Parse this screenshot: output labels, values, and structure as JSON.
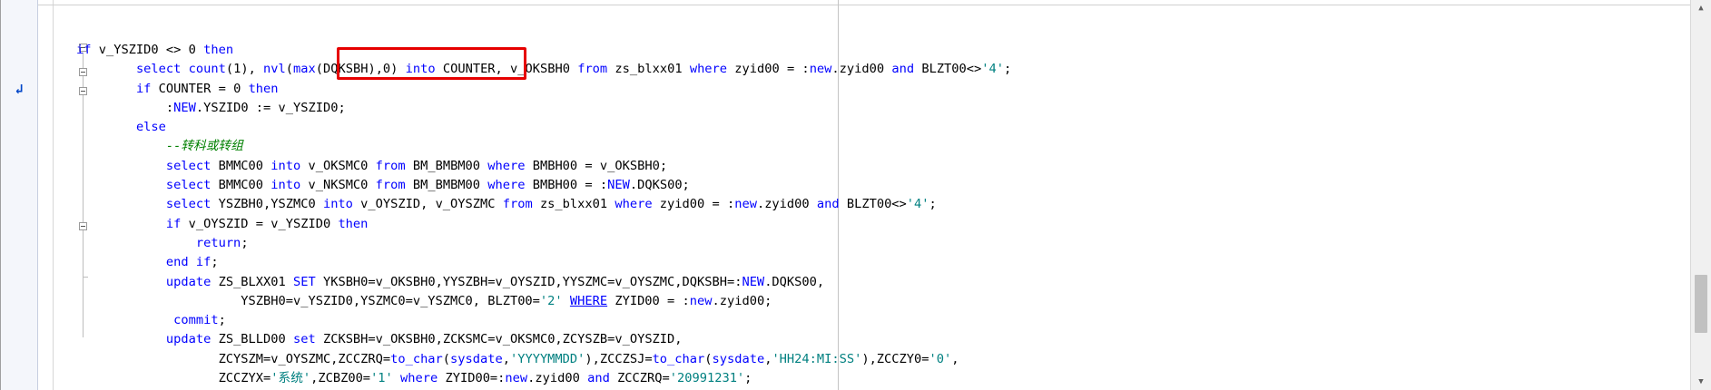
{
  "editor": {
    "lines": [
      [
        {
          "t": "if",
          "c": "kw"
        },
        {
          "t": " v_YSZID0 <> 0 "
        },
        {
          "t": "then",
          "c": "kw"
        }
      ],
      [
        {
          "t": "        "
        },
        {
          "t": "select",
          "c": "kw"
        },
        {
          "t": " "
        },
        {
          "t": "count",
          "c": "fn"
        },
        {
          "t": "(1), "
        },
        {
          "t": "nvl",
          "c": "fn"
        },
        {
          "t": "("
        },
        {
          "t": "max",
          "c": "fn"
        },
        {
          "t": "(DQKSBH),0) "
        },
        {
          "t": "into",
          "c": "kw"
        },
        {
          "t": " COUNTER, v_OKSBH0 "
        },
        {
          "t": "from",
          "c": "kw"
        },
        {
          "t": " zs_blxx01 "
        },
        {
          "t": "where",
          "c": "kw"
        },
        {
          "t": " zyid00 = :"
        },
        {
          "t": "new",
          "c": "kw"
        },
        {
          "t": ".zyid00 "
        },
        {
          "t": "and",
          "c": "kw"
        },
        {
          "t": " BLZT00<>"
        },
        {
          "t": "'4'",
          "c": "str"
        },
        {
          "t": ";"
        }
      ],
      [
        {
          "t": "        "
        },
        {
          "t": "if",
          "c": "kw"
        },
        {
          "t": " COUNTER = 0 "
        },
        {
          "t": "then",
          "c": "kw"
        }
      ],
      [
        {
          "t": "            :"
        },
        {
          "t": "NEW",
          "c": "kw"
        },
        {
          "t": ".YSZID0 := v_YSZID0;"
        }
      ],
      [
        {
          "t": "        "
        },
        {
          "t": "else",
          "c": "kw"
        }
      ],
      [
        {
          "t": "            "
        },
        {
          "t": "--转科或转组",
          "c": "cmt"
        }
      ],
      [
        {
          "t": "            "
        },
        {
          "t": "select",
          "c": "kw"
        },
        {
          "t": " BMMC00 "
        },
        {
          "t": "into",
          "c": "kw"
        },
        {
          "t": " v_OKSMC0 "
        },
        {
          "t": "from",
          "c": "kw"
        },
        {
          "t": " BM_BMBM00 "
        },
        {
          "t": "where",
          "c": "kw"
        },
        {
          "t": " BMBH00 = v_OKSBH0;"
        }
      ],
      [
        {
          "t": "            "
        },
        {
          "t": "select",
          "c": "kw"
        },
        {
          "t": " BMMC00 "
        },
        {
          "t": "into",
          "c": "kw"
        },
        {
          "t": " v_NKSMC0 "
        },
        {
          "t": "from",
          "c": "kw"
        },
        {
          "t": " BM_BMBM00 "
        },
        {
          "t": "where",
          "c": "kw"
        },
        {
          "t": " BMBH00 = :"
        },
        {
          "t": "NEW",
          "c": "kw"
        },
        {
          "t": ".DQKS00;"
        }
      ],
      [
        {
          "t": "            "
        },
        {
          "t": "select",
          "c": "kw"
        },
        {
          "t": " YSZBH0,YSZMC0 "
        },
        {
          "t": "into",
          "c": "kw"
        },
        {
          "t": " v_OYSZID, v_OYSZMC "
        },
        {
          "t": "from",
          "c": "kw"
        },
        {
          "t": " zs_blxx01 "
        },
        {
          "t": "where",
          "c": "kw"
        },
        {
          "t": " zyid00 = :"
        },
        {
          "t": "new",
          "c": "kw"
        },
        {
          "t": ".zyid00 "
        },
        {
          "t": "and",
          "c": "kw"
        },
        {
          "t": " BLZT00<>"
        },
        {
          "t": "'4'",
          "c": "str"
        },
        {
          "t": ";"
        }
      ],
      [
        {
          "t": "            "
        },
        {
          "t": "if",
          "c": "kw"
        },
        {
          "t": " v_OYSZID = v_YSZID0 "
        },
        {
          "t": "then",
          "c": "kw"
        }
      ],
      [
        {
          "t": "                "
        },
        {
          "t": "return",
          "c": "kw"
        },
        {
          "t": ";"
        }
      ],
      [
        {
          "t": "            "
        },
        {
          "t": "end if",
          "c": "kw"
        },
        {
          "t": ";"
        }
      ],
      [
        {
          "t": "            "
        },
        {
          "t": "update",
          "c": "kw"
        },
        {
          "t": " ZS_BLXX01 "
        },
        {
          "t": "SET",
          "c": "kw"
        },
        {
          "t": " YKSBH0=v_OKSBH0,YYSZBH=v_OYSZID,YYSZMC=v_OYSZMC,DQKSBH=:"
        },
        {
          "t": "NEW",
          "c": "kw"
        },
        {
          "t": ".DQKS00,"
        }
      ],
      [
        {
          "t": "                      YSZBH0=v_YSZID0,YSZMC0=v_YSZMC0, BLZT00="
        },
        {
          "t": "'2'",
          "c": "str"
        },
        {
          "t": " "
        },
        {
          "t": "WHERE",
          "c": "link"
        },
        {
          "t": " ZYID00 = :"
        },
        {
          "t": "new",
          "c": "kw"
        },
        {
          "t": ".zyid00;"
        }
      ],
      [
        {
          "t": "             "
        },
        {
          "t": "commit",
          "c": "kw"
        },
        {
          "t": ";"
        }
      ],
      [
        {
          "t": "            "
        },
        {
          "t": "update",
          "c": "kw"
        },
        {
          "t": " ZS_BLLD00 "
        },
        {
          "t": "set",
          "c": "kw"
        },
        {
          "t": " ZCKSBH=v_OKSBH0,ZCKSMC=v_OKSMC0,ZCYSZB=v_OYSZID,"
        }
      ],
      [
        {
          "t": "                   ZCYSZM=v_OYSZMC,ZCCZRQ="
        },
        {
          "t": "to_char",
          "c": "fn"
        },
        {
          "t": "("
        },
        {
          "t": "sysdate",
          "c": "kw"
        },
        {
          "t": ","
        },
        {
          "t": "'YYYYMMDD'",
          "c": "str"
        },
        {
          "t": "),ZCCZSJ="
        },
        {
          "t": "to_char",
          "c": "fn"
        },
        {
          "t": "("
        },
        {
          "t": "sysdate",
          "c": "kw"
        },
        {
          "t": ","
        },
        {
          "t": "'HH24:MI:SS'",
          "c": "str"
        },
        {
          "t": "),ZCCZY0="
        },
        {
          "t": "'0'",
          "c": "str"
        },
        {
          "t": ","
        }
      ],
      [
        {
          "t": "                   ZCCZYX="
        },
        {
          "t": "'系统'",
          "c": "str"
        },
        {
          "t": ",ZCBZ00="
        },
        {
          "t": "'1'",
          "c": "str"
        },
        {
          "t": " "
        },
        {
          "t": "where",
          "c": "kw"
        },
        {
          "t": " ZYID00=:"
        },
        {
          "t": "new",
          "c": "kw"
        },
        {
          "t": ".zyid00 "
        },
        {
          "t": "and",
          "c": "kw"
        },
        {
          "t": " ZCCZRQ="
        },
        {
          "t": "'20991231'",
          "c": "str"
        },
        {
          "t": ";"
        }
      ]
    ]
  },
  "gutter": {
    "execution_marker_icon": "current-line-arrow-icon"
  },
  "scrollbar": {
    "up_icon": "scroll-up-arrow-icon",
    "down_icon": "scroll-down-arrow-icon"
  },
  "colors": {
    "keyword": "#0000ff",
    "string": "#008080",
    "comment": "#008000",
    "highlight_box": "#e60000"
  }
}
